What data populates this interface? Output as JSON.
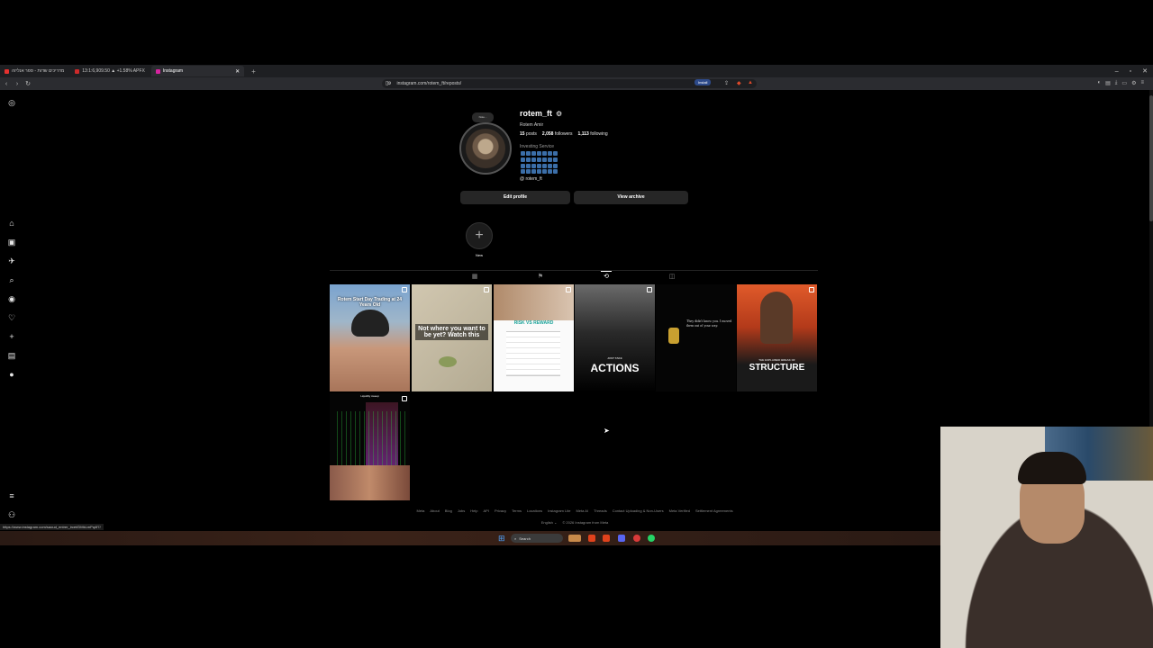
{
  "browser": {
    "tabs": [
      {
        "label": "מדריכים שדות - ספר אנליזה",
        "fav_color": "#e5312f",
        "active": false
      },
      {
        "label": "13:1:6,909.50 ▲ +1.58% APFX",
        "fav_color": "#cc2a2a",
        "active": false
      },
      {
        "label": "Instagram",
        "fav_color": "#d6249f",
        "active": true
      }
    ],
    "new_tab": "+",
    "url": "instagram.com/rotem_ft/reposts/",
    "install_label": "Install",
    "status_url": "https://www.instagram.com/saoud_entrer_ircet/DMkLmPq4f7/"
  },
  "sidebar": {
    "items": [
      {
        "name": "instagram-logo-icon",
        "glyph": "◎"
      },
      {
        "name": "home-icon",
        "glyph": "⌂"
      },
      {
        "name": "reels-icon",
        "glyph": "▣"
      },
      {
        "name": "messages-icon",
        "glyph": "✈"
      },
      {
        "name": "search-icon",
        "glyph": "⌕"
      },
      {
        "name": "explore-icon",
        "glyph": "◉"
      },
      {
        "name": "notifications-icon",
        "glyph": "♡"
      },
      {
        "name": "create-icon",
        "glyph": "+"
      },
      {
        "name": "dashboard-icon",
        "glyph": "▤"
      },
      {
        "name": "profile-icon",
        "glyph": "●"
      },
      {
        "name": "more-menu-icon",
        "glyph": "≡"
      },
      {
        "name": "also-from-meta-icon",
        "glyph": "⚇"
      }
    ]
  },
  "profile": {
    "note": "Note...",
    "username": "rotem_ft",
    "full_name": "Rotem Amir",
    "posts": "15",
    "posts_label": "posts",
    "followers": "2,058",
    "followers_label": "followers",
    "following": "1,113",
    "following_label": "following",
    "category": "Investing Service",
    "threads_handle": "rotem_ft",
    "edit_profile": "Edit profile",
    "view_archive": "View archive",
    "new_highlight_label": "New"
  },
  "posts": [
    {
      "caption": "Rotem Start Day Trading at 24 Years Old",
      "colors": [
        "#6b8fb8",
        "#c69a7a"
      ]
    },
    {
      "caption": "Not where you want to be yet? Watch this",
      "colors": [
        "#c9bfa8",
        "#b7ad94"
      ]
    },
    {
      "caption": "RISK VS REWARD",
      "colors": [
        "#f0f0f0",
        "#ffffff"
      ]
    },
    {
      "caption": "ACTIONS",
      "subcaption": "JUST TAKE",
      "colors": [
        "#1a1a1a",
        "#000000"
      ]
    },
    {
      "caption": "They didn't know you. I moved them out of your way.",
      "colors": [
        "#0a0a0a",
        "#000000"
      ]
    },
    {
      "caption": "STRUCTURE",
      "subcaption": "THE EXPLAINED BREAK OF",
      "colors": [
        "#d24a22",
        "#1a1a1a"
      ]
    },
    {
      "caption": "Liquidity sweep",
      "colors": [
        "#0a0a0a",
        "#2a0a2a"
      ]
    }
  ],
  "footer": {
    "links": [
      "Meta",
      "About",
      "Blog",
      "Jobs",
      "Help",
      "API",
      "Privacy",
      "Terms",
      "Locations",
      "Instagram Lite",
      "Meta AI",
      "Threads",
      "Contact Uploading & Non-Users",
      "Meta Verified",
      "Settlement Agreements"
    ],
    "language": "English",
    "copyright": "© 2026 Instagram from Meta"
  },
  "taskbar": {
    "search_placeholder": "Search"
  }
}
